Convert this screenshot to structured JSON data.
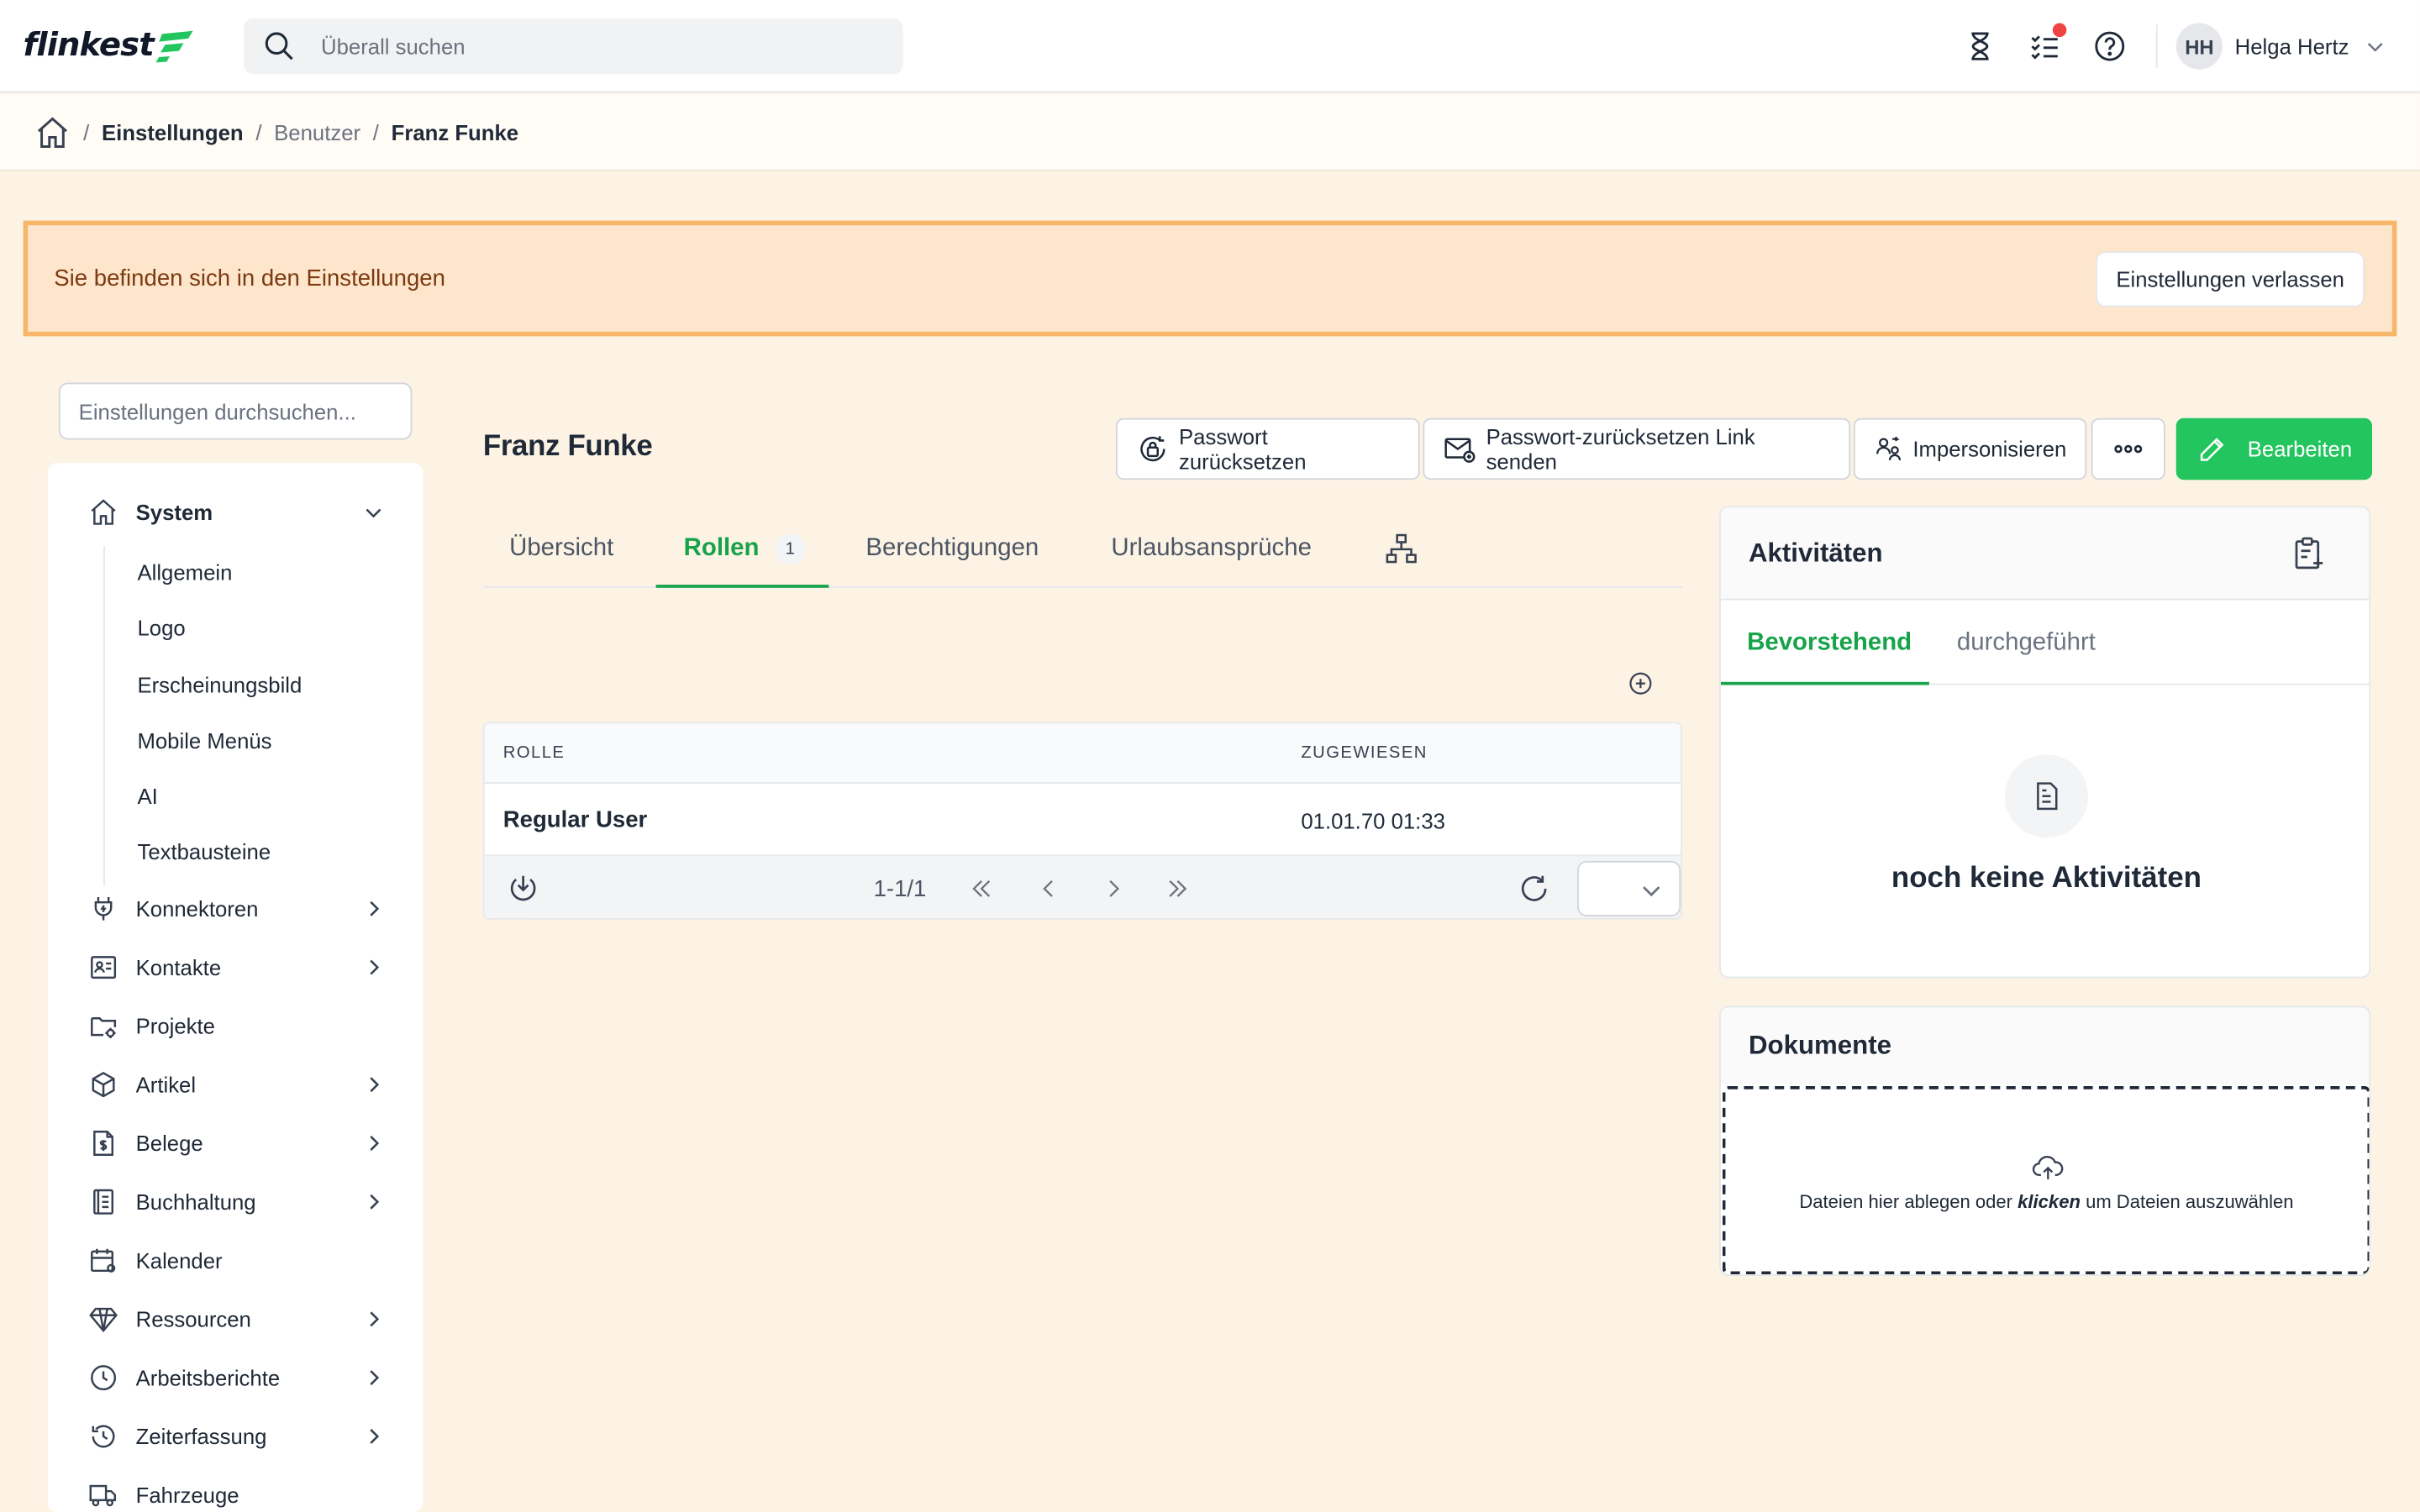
{
  "app": {
    "logo_text": "flinkest"
  },
  "topbar": {
    "search_placeholder": "Überall suchen",
    "user_initials": "HH",
    "user_name": "Helga Hertz"
  },
  "breadcrumb": {
    "items": [
      "Einstellungen",
      "Benutzer",
      "Franz Funke"
    ]
  },
  "banner": {
    "text": "Sie befinden sich in den Einstellungen",
    "leave_label": "Einstellungen verlassen"
  },
  "sidebar": {
    "search_placeholder": "Einstellungen durchsuchen...",
    "system_label": "System",
    "sub_items": [
      "Allgemein",
      "Logo",
      "Erscheinungsbild",
      "Mobile Menüs",
      "AI",
      "Textbausteine"
    ],
    "items": [
      {
        "label": "Konnektoren",
        "icon": "plug-icon",
        "has_children": true
      },
      {
        "label": "Kontakte",
        "icon": "contact-card-icon",
        "has_children": true
      },
      {
        "label": "Projekte",
        "icon": "folder-gear-icon",
        "has_children": false
      },
      {
        "label": "Artikel",
        "icon": "box-icon",
        "has_children": true
      },
      {
        "label": "Belege",
        "icon": "receipt-dollar-icon",
        "has_children": true
      },
      {
        "label": "Buchhaltung",
        "icon": "ledger-icon",
        "has_children": true
      },
      {
        "label": "Kalender",
        "icon": "calendar-gear-icon",
        "has_children": false
      },
      {
        "label": "Ressourcen",
        "icon": "diamond-icon",
        "has_children": true
      },
      {
        "label": "Arbeitsberichte",
        "icon": "clock-report-icon",
        "has_children": true
      },
      {
        "label": "Zeiterfassung",
        "icon": "history-icon",
        "has_children": true
      },
      {
        "label": "Fahrzeuge",
        "icon": "truck-icon",
        "has_children": false
      }
    ]
  },
  "main": {
    "title": "Franz Funke",
    "actions": {
      "reset_password": "Passwort zurücksetzen",
      "send_reset_link": "Passwort-zurücksetzen Link senden",
      "impersonate": "Impersonisieren",
      "edit": "Bearbeiten"
    },
    "tabs": [
      {
        "label": "Übersicht"
      },
      {
        "label": "Rollen",
        "count": "1"
      },
      {
        "label": "Berechtigungen"
      },
      {
        "label": "Urlaubsansprüche"
      }
    ],
    "grid": {
      "columns": [
        "ROLLE",
        "ZUGEWIESEN"
      ],
      "rows": [
        {
          "role": "Regular User",
          "assigned": "01.01.70 01:33"
        }
      ],
      "pagination_text": "1-1/1"
    }
  },
  "activities": {
    "title": "Aktivitäten",
    "tabs": [
      "Bevorstehend",
      "durchgeführt"
    ],
    "empty_text": "noch keine Aktivitäten"
  },
  "documents": {
    "title": "Dokumente",
    "drop_text_before": "Dateien hier ablegen oder",
    "drop_text_emph": "klicken",
    "drop_text_after": "um Dateien auszuwählen"
  },
  "colors": {
    "accent_green": "#22c55e",
    "active_tab_green": "#16a34a",
    "banner_bg": "#fde6cc",
    "banner_border": "#f7b669",
    "page_bg": "#fdf3e4",
    "notification_dot": "#ef4444"
  }
}
